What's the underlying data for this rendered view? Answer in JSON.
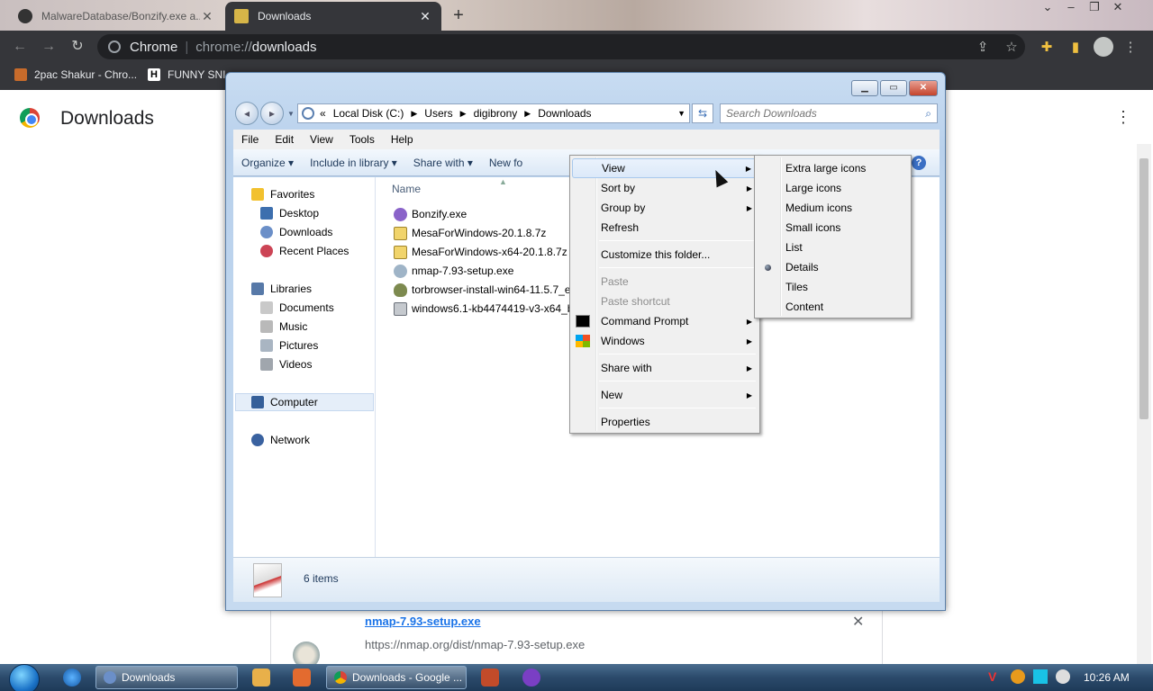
{
  "browser": {
    "tabs": [
      {
        "title": "MalwareDatabase/Bonzify.exe a...",
        "close": "✕"
      },
      {
        "title": "Downloads",
        "close": "✕"
      }
    ],
    "new_tab": "+",
    "address": {
      "origin": "Chrome",
      "separator": "|",
      "prefix": "chrome://",
      "path": "downloads"
    },
    "bookmarks": [
      "2pac Shakur - Chro...",
      "FUNNY SNI"
    ]
  },
  "downloads_page": {
    "title": "Downloads",
    "menu": "⋮",
    "item": {
      "file_name": "nmap-7.93-setup.exe",
      "url": "https://nmap.org/dist/nmap-7.93-setup.exe",
      "close": "✕"
    }
  },
  "explorer": {
    "address_parts": [
      "Local Disk (C:)",
      "Users",
      "digibrony",
      "Downloads"
    ],
    "address_lead": "«",
    "search_placeholder": "Search Downloads",
    "menubar": [
      "File",
      "Edit",
      "View",
      "Tools",
      "Help"
    ],
    "commands": [
      "Organize ▾",
      "Include in library ▾",
      "Share with ▾",
      "New fo"
    ],
    "nav": {
      "favorites": "Favorites",
      "favorites_items": [
        "Desktop",
        "Downloads",
        "Recent Places"
      ],
      "libraries": "Libraries",
      "libraries_items": [
        "Documents",
        "Music",
        "Pictures",
        "Videos"
      ],
      "computer": "Computer",
      "network": "Network"
    },
    "column_name": "Name",
    "files": [
      "Bonzify.exe",
      "MesaForWindows-20.1.8.7z",
      "MesaForWindows-x64-20.1.8.7z",
      "nmap-7.93-setup.exe",
      "torbrowser-install-win64-11.5.7_en-US.exe",
      "windows6.1-kb4474419-v3-x64_b5614c6cea5cb4e198717789633dca16308ef79c.msu"
    ],
    "status": "6 items"
  },
  "context_menu": {
    "items": [
      {
        "label": "View",
        "submenu": true
      },
      {
        "label": "Sort by",
        "submenu": true
      },
      {
        "label": "Group by",
        "submenu": true
      },
      {
        "label": "Refresh"
      },
      {
        "label": "Customize this folder..."
      },
      {
        "label": "Paste",
        "disabled": true
      },
      {
        "label": "Paste shortcut",
        "disabled": true
      },
      {
        "label": "Command Prompt",
        "submenu": true
      },
      {
        "label": "Windows",
        "submenu": true
      },
      {
        "label": "Share with",
        "submenu": true
      },
      {
        "label": "New",
        "submenu": true
      },
      {
        "label": "Properties"
      }
    ],
    "arrow": "▶"
  },
  "view_submenu": {
    "items": [
      "Extra large icons",
      "Large icons",
      "Medium icons",
      "Small icons",
      "List",
      "Details",
      "Tiles",
      "Content"
    ],
    "selected": "Details"
  },
  "taskbar": {
    "buttons": [
      "Downloads",
      "Downloads - Google ..."
    ],
    "clock": "10:26 AM"
  },
  "colors": {
    "chrome_dark": "#35363a",
    "explorer_frame": "#c8dcf2",
    "link_blue": "#1a73e8"
  }
}
